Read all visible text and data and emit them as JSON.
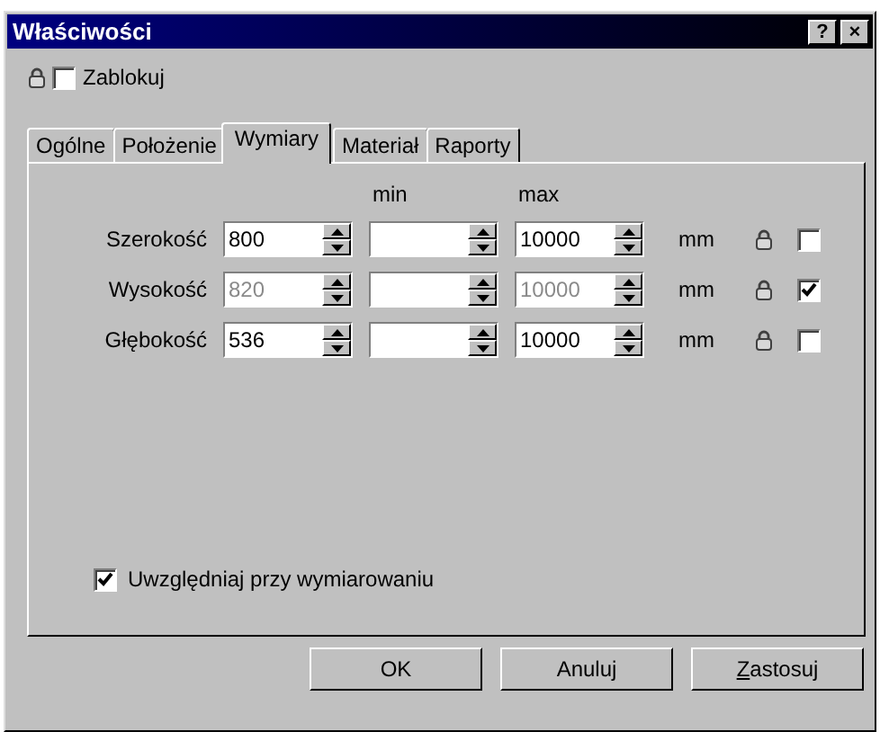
{
  "window": {
    "title": "Właściwości",
    "title_buttons": [
      "?",
      "×"
    ]
  },
  "lock": {
    "label": "Zablokuj",
    "checked": false
  },
  "tabs": [
    {
      "label": "Ogólne",
      "selected": false
    },
    {
      "label": "Położenie",
      "selected": false
    },
    {
      "label": "Wymiary",
      "selected": true
    },
    {
      "label": "Materiał",
      "selected": false
    },
    {
      "label": "Raporty",
      "selected": false
    }
  ],
  "columns": {
    "min": "min",
    "max": "max"
  },
  "rows": [
    {
      "label": "Szerokość",
      "value": "800",
      "min": "",
      "max": "10000",
      "unit": "mm",
      "disabled": false,
      "locked": false
    },
    {
      "label": "Wysokość",
      "value": "820",
      "min": "",
      "max": "10000",
      "unit": "mm",
      "disabled": true,
      "locked": true
    },
    {
      "label": "Głębokość",
      "value": "536",
      "min": "",
      "max": "10000",
      "unit": "mm",
      "disabled": false,
      "locked": false
    }
  ],
  "include": {
    "label": "Uwzględniaj przy wymiarowaniu",
    "checked": true
  },
  "buttons": [
    {
      "label": "OK",
      "underline_first": false
    },
    {
      "label": "Anuluj",
      "underline_first": false
    },
    {
      "label": "Zastosuj",
      "underline_first": true
    }
  ]
}
